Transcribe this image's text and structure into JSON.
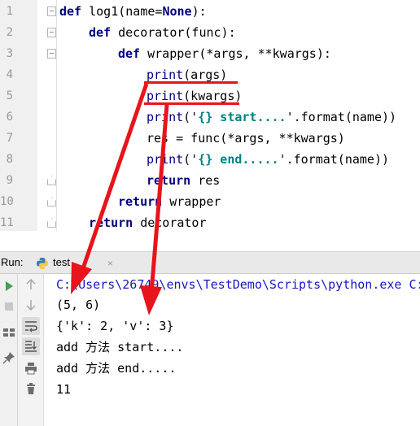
{
  "editor": {
    "lines": [
      {
        "num": "1",
        "segments": [
          {
            "t": "def ",
            "c": "kw"
          },
          {
            "t": "log1(name=",
            "c": ""
          },
          {
            "t": "None",
            "c": "kw"
          },
          {
            "t": "):",
            "c": ""
          }
        ]
      },
      {
        "num": "2",
        "segments": [
          {
            "t": "def ",
            "c": "kw"
          },
          {
            "t": "decorator(func):",
            "c": ""
          }
        ]
      },
      {
        "num": "3",
        "segments": [
          {
            "t": "def ",
            "c": "kw"
          },
          {
            "t": "wrapper(*args, **kwargs):",
            "c": ""
          }
        ]
      },
      {
        "num": "4",
        "segments": [
          {
            "t": "print",
            "c": "bi"
          },
          {
            "t": "(args)",
            "c": ""
          }
        ]
      },
      {
        "num": "5",
        "segments": [
          {
            "t": "print",
            "c": "bi"
          },
          {
            "t": "(kwargs)",
            "c": ""
          }
        ]
      },
      {
        "num": "6",
        "segments": [
          {
            "t": "print",
            "c": "bi"
          },
          {
            "t": "('",
            "c": ""
          },
          {
            "t": "{} start....",
            "c": "str"
          },
          {
            "t": "'.format(name))",
            "c": ""
          }
        ]
      },
      {
        "num": "7",
        "segments": [
          {
            "t": "res = func(*args, **kwargs)",
            "c": ""
          }
        ]
      },
      {
        "num": "8",
        "segments": [
          {
            "t": "print",
            "c": "bi"
          },
          {
            "t": "('",
            "c": ""
          },
          {
            "t": "{} end.....",
            "c": "str"
          },
          {
            "t": "'.format(name))",
            "c": ""
          }
        ]
      },
      {
        "num": "9",
        "segments": [
          {
            "t": "return ",
            "c": "kw"
          },
          {
            "t": "res",
            "c": ""
          }
        ]
      },
      {
        "num": "10",
        "segments": [
          {
            "t": "return ",
            "c": "kw"
          },
          {
            "t": "wrapper",
            "c": ""
          }
        ]
      },
      {
        "num": "11",
        "segments": [
          {
            "t": "return ",
            "c": "kw"
          },
          {
            "t": "decorator",
            "c": ""
          }
        ]
      }
    ]
  },
  "run_panel": {
    "label": "Run:",
    "tab_label": "test",
    "tab_close": "×",
    "toolbar_icons": [
      "run-icon",
      "stop-icon",
      "layout-icon",
      "pin-icon",
      "scroll-up-icon",
      "scroll-down-icon",
      "soft-wrap-icon",
      "scroll-to-end-icon",
      "print-icon",
      "trash-icon"
    ],
    "console_lines": [
      "C:\\Users\\26749\\envs\\TestDemo\\Scripts\\python.exe C:",
      "(5, 6)",
      "{'k': 2, 'v': 3}",
      "add 方法 start....",
      "add 方法 end.....",
      "11"
    ]
  },
  "colors": {
    "keyword": "#000080",
    "string": "#008080",
    "annotation_red": "#e8141b",
    "console_path": "#1717c1"
  }
}
